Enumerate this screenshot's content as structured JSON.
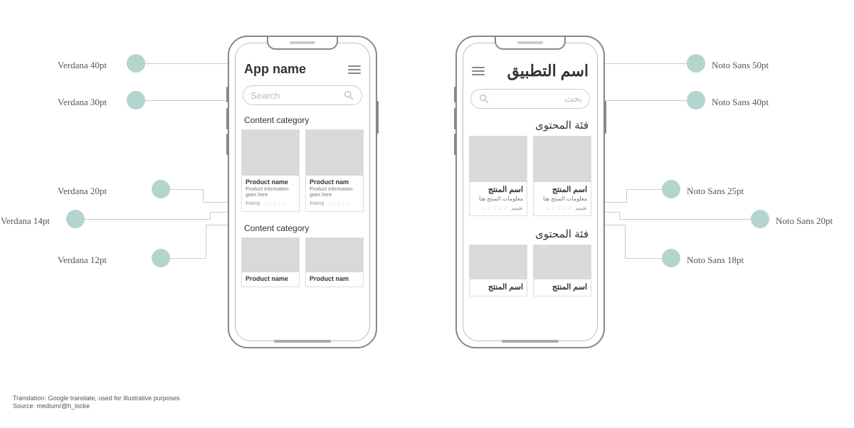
{
  "callouts_left": [
    {
      "label": "Verdana 40pt"
    },
    {
      "label": "Verdana 30pt"
    },
    {
      "label": "Verdana 20pt"
    },
    {
      "label": "Verdana 14pt"
    },
    {
      "label": "Verdana 12pt"
    }
  ],
  "callouts_right": [
    {
      "label": "Noto Sans 50pt"
    },
    {
      "label": "Noto Sans 40pt"
    },
    {
      "label": "Noto Sans 25pt"
    },
    {
      "label": "Noto Sans 20pt"
    },
    {
      "label": "Noto Sans 18pt"
    }
  ],
  "ltr": {
    "app_name": "App name",
    "search_placeholder": "Search",
    "category": "Content category",
    "product_name": "Product name",
    "product_name_cut": "Product nam",
    "product_info": "Product information goes here",
    "rating_label": "Rating"
  },
  "rtl": {
    "app_name": "اسم التطبيق",
    "search_placeholder": "بحث",
    "category": "فئة المحتوى",
    "product_name": "اسم المنتج",
    "product_info": "معلومات المنتج هنا",
    "rating_label": "تقييم"
  },
  "stars": "☆☆☆☆☆",
  "footnote_line1": "Translation: Google translate, used for illustrative purposes",
  "footnote_line2": "Source: medium/@h_locke"
}
